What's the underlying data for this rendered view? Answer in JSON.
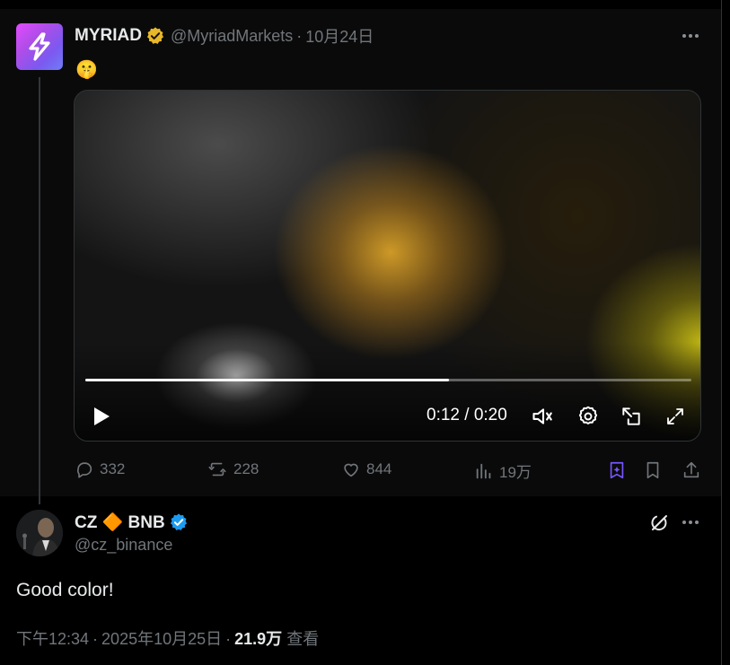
{
  "colors": {
    "background": "#000000",
    "parent_background": "#0a0a0a",
    "text_primary": "#e7e9ea",
    "text_secondary": "#71767b",
    "verified_gold": "#e8b829",
    "verified_blue": "#1d9bf0",
    "grok_purple": "#7856ff"
  },
  "parent_tweet": {
    "display_name": "MYRIAD",
    "verified_badge": "gold-verified-icon",
    "handle": "@MyriadMarkets",
    "separator": "·",
    "date": "10月24日",
    "text": "🤫",
    "video": {
      "progress_fraction": 0.6,
      "time_display": "0:12 / 0:20",
      "controls": [
        "play-icon",
        "volume-icon",
        "settings-icon",
        "pop-out-icon",
        "fullscreen-icon"
      ]
    },
    "actions": {
      "replies": "332",
      "reposts": "228",
      "likes": "844",
      "views": "19万"
    }
  },
  "main_tweet": {
    "display_name": "CZ 🔶 BNB",
    "verified_badge": "blue-verified-icon",
    "handle": "@cz_binance",
    "text": "Good color!",
    "time": "下午12:34",
    "separator": "·",
    "date": "2025年10月25日",
    "views_count": "21.9万",
    "views_label": "查看"
  }
}
